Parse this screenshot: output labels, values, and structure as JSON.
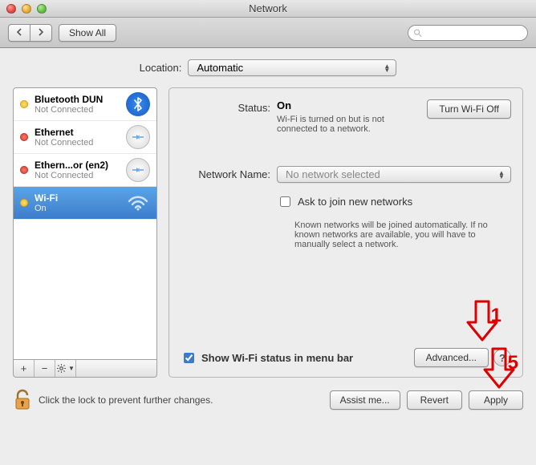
{
  "window": {
    "title": "Network"
  },
  "toolbar": {
    "show_all": "Show All",
    "search_placeholder": ""
  },
  "location": {
    "label": "Location:",
    "value": "Automatic"
  },
  "sidebar": {
    "services": [
      {
        "name": "Bluetooth DUN",
        "sub": "Not Connected",
        "dot": "yellow",
        "icon": "bluetooth",
        "selected": false
      },
      {
        "name": "Ethernet",
        "sub": "Not Connected",
        "dot": "red",
        "icon": "ethernet",
        "selected": false
      },
      {
        "name": "Ethern...or (en2)",
        "sub": "Not Connected",
        "dot": "red",
        "icon": "ethernet",
        "selected": false
      },
      {
        "name": "Wi-Fi",
        "sub": "On",
        "dot": "yellow",
        "icon": "wifi",
        "selected": true
      }
    ],
    "buttons": {
      "add": "+",
      "remove": "−",
      "gear": "gear"
    }
  },
  "detail": {
    "status_label": "Status:",
    "status_value": "On",
    "turn_off_btn": "Turn Wi-Fi Off",
    "status_note": "Wi-Fi is turned on but is not connected to a network.",
    "network_name_label": "Network Name:",
    "network_name_value": "No network selected",
    "ask_join": "Ask to join new networks",
    "ask_join_hint": "Known networks will be joined automatically. If no known networks are available, you will have to manually select a network.",
    "show_status": "Show Wi-Fi status in menu bar",
    "advanced_btn": "Advanced...",
    "help": "?"
  },
  "footer": {
    "lock_text": "Click the lock to prevent further changes.",
    "assist": "Assist me...",
    "revert": "Revert",
    "apply": "Apply"
  },
  "annotations": {
    "step1": "1",
    "step5": "5"
  }
}
